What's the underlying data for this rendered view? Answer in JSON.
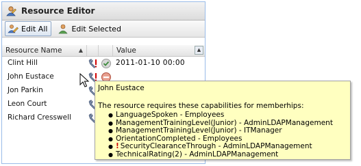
{
  "window": {
    "title": "Resource Editor"
  },
  "toolbar": {
    "edit_all_label": "Edit All",
    "edit_selected_label": "Edit Selected"
  },
  "grid": {
    "columns": {
      "name": "Resource Name",
      "value": "Value"
    },
    "rows": [
      {
        "name": "Clint Hill",
        "value": "2011-01-10 00:00",
        "status": "ok"
      },
      {
        "name": "John Eustace",
        "value": "",
        "status": "blocked"
      },
      {
        "name": "Jon Parkin",
        "value": "",
        "status": ""
      },
      {
        "name": "Leon Court",
        "value": "",
        "status": ""
      },
      {
        "name": "Richard Cresswell",
        "value": "",
        "status": ""
      }
    ]
  },
  "tooltip": {
    "name": "John Eustace",
    "intro": "The resource requires these capabilities for memberhips:",
    "items": [
      {
        "text": "LanguageSpoken - Employees",
        "warning": ""
      },
      {
        "text": "ManagementTrainingLevel(Junior) - AdminLDAPManagement",
        "warning": ""
      },
      {
        "text": "ManagementTrainingLevel(Junior) - ITManager",
        "warning": ""
      },
      {
        "text": "OrientationCompleted - Employees",
        "warning": ""
      },
      {
        "text": "SecurityClearanceThrough - AdminLDAPManagement",
        "warning": "!"
      },
      {
        "text": "TechnicalRating(2) - AdminLDAPManagement",
        "warning": ""
      }
    ]
  },
  "colors": {
    "tooltip_bg": "#ffffc0",
    "warning": "#d00000",
    "panel_border": "#99bbe8"
  }
}
